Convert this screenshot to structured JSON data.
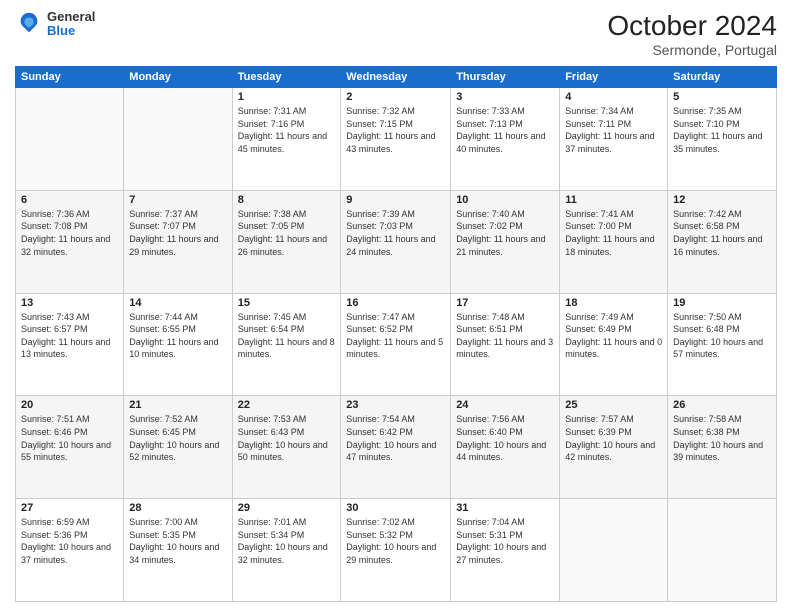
{
  "header": {
    "logo": {
      "general": "General",
      "blue": "Blue"
    },
    "title": "October 2024",
    "subtitle": "Sermonde, Portugal"
  },
  "days_of_week": [
    "Sunday",
    "Monday",
    "Tuesday",
    "Wednesday",
    "Thursday",
    "Friday",
    "Saturday"
  ],
  "weeks": [
    [
      {
        "day": "",
        "info": ""
      },
      {
        "day": "",
        "info": ""
      },
      {
        "day": "1",
        "info": "Sunrise: 7:31 AM\nSunset: 7:16 PM\nDaylight: 11 hours and 45 minutes."
      },
      {
        "day": "2",
        "info": "Sunrise: 7:32 AM\nSunset: 7:15 PM\nDaylight: 11 hours and 43 minutes."
      },
      {
        "day": "3",
        "info": "Sunrise: 7:33 AM\nSunset: 7:13 PM\nDaylight: 11 hours and 40 minutes."
      },
      {
        "day": "4",
        "info": "Sunrise: 7:34 AM\nSunset: 7:11 PM\nDaylight: 11 hours and 37 minutes."
      },
      {
        "day": "5",
        "info": "Sunrise: 7:35 AM\nSunset: 7:10 PM\nDaylight: 11 hours and 35 minutes."
      }
    ],
    [
      {
        "day": "6",
        "info": "Sunrise: 7:36 AM\nSunset: 7:08 PM\nDaylight: 11 hours and 32 minutes."
      },
      {
        "day": "7",
        "info": "Sunrise: 7:37 AM\nSunset: 7:07 PM\nDaylight: 11 hours and 29 minutes."
      },
      {
        "day": "8",
        "info": "Sunrise: 7:38 AM\nSunset: 7:05 PM\nDaylight: 11 hours and 26 minutes."
      },
      {
        "day": "9",
        "info": "Sunrise: 7:39 AM\nSunset: 7:03 PM\nDaylight: 11 hours and 24 minutes."
      },
      {
        "day": "10",
        "info": "Sunrise: 7:40 AM\nSunset: 7:02 PM\nDaylight: 11 hours and 21 minutes."
      },
      {
        "day": "11",
        "info": "Sunrise: 7:41 AM\nSunset: 7:00 PM\nDaylight: 11 hours and 18 minutes."
      },
      {
        "day": "12",
        "info": "Sunrise: 7:42 AM\nSunset: 6:58 PM\nDaylight: 11 hours and 16 minutes."
      }
    ],
    [
      {
        "day": "13",
        "info": "Sunrise: 7:43 AM\nSunset: 6:57 PM\nDaylight: 11 hours and 13 minutes."
      },
      {
        "day": "14",
        "info": "Sunrise: 7:44 AM\nSunset: 6:55 PM\nDaylight: 11 hours and 10 minutes."
      },
      {
        "day": "15",
        "info": "Sunrise: 7:45 AM\nSunset: 6:54 PM\nDaylight: 11 hours and 8 minutes."
      },
      {
        "day": "16",
        "info": "Sunrise: 7:47 AM\nSunset: 6:52 PM\nDaylight: 11 hours and 5 minutes."
      },
      {
        "day": "17",
        "info": "Sunrise: 7:48 AM\nSunset: 6:51 PM\nDaylight: 11 hours and 3 minutes."
      },
      {
        "day": "18",
        "info": "Sunrise: 7:49 AM\nSunset: 6:49 PM\nDaylight: 11 hours and 0 minutes."
      },
      {
        "day": "19",
        "info": "Sunrise: 7:50 AM\nSunset: 6:48 PM\nDaylight: 10 hours and 57 minutes."
      }
    ],
    [
      {
        "day": "20",
        "info": "Sunrise: 7:51 AM\nSunset: 6:46 PM\nDaylight: 10 hours and 55 minutes."
      },
      {
        "day": "21",
        "info": "Sunrise: 7:52 AM\nSunset: 6:45 PM\nDaylight: 10 hours and 52 minutes."
      },
      {
        "day": "22",
        "info": "Sunrise: 7:53 AM\nSunset: 6:43 PM\nDaylight: 10 hours and 50 minutes."
      },
      {
        "day": "23",
        "info": "Sunrise: 7:54 AM\nSunset: 6:42 PM\nDaylight: 10 hours and 47 minutes."
      },
      {
        "day": "24",
        "info": "Sunrise: 7:56 AM\nSunset: 6:40 PM\nDaylight: 10 hours and 44 minutes."
      },
      {
        "day": "25",
        "info": "Sunrise: 7:57 AM\nSunset: 6:39 PM\nDaylight: 10 hours and 42 minutes."
      },
      {
        "day": "26",
        "info": "Sunrise: 7:58 AM\nSunset: 6:38 PM\nDaylight: 10 hours and 39 minutes."
      }
    ],
    [
      {
        "day": "27",
        "info": "Sunrise: 6:59 AM\nSunset: 5:36 PM\nDaylight: 10 hours and 37 minutes."
      },
      {
        "day": "28",
        "info": "Sunrise: 7:00 AM\nSunset: 5:35 PM\nDaylight: 10 hours and 34 minutes."
      },
      {
        "day": "29",
        "info": "Sunrise: 7:01 AM\nSunset: 5:34 PM\nDaylight: 10 hours and 32 minutes."
      },
      {
        "day": "30",
        "info": "Sunrise: 7:02 AM\nSunset: 5:32 PM\nDaylight: 10 hours and 29 minutes."
      },
      {
        "day": "31",
        "info": "Sunrise: 7:04 AM\nSunset: 5:31 PM\nDaylight: 10 hours and 27 minutes."
      },
      {
        "day": "",
        "info": ""
      },
      {
        "day": "",
        "info": ""
      }
    ]
  ]
}
